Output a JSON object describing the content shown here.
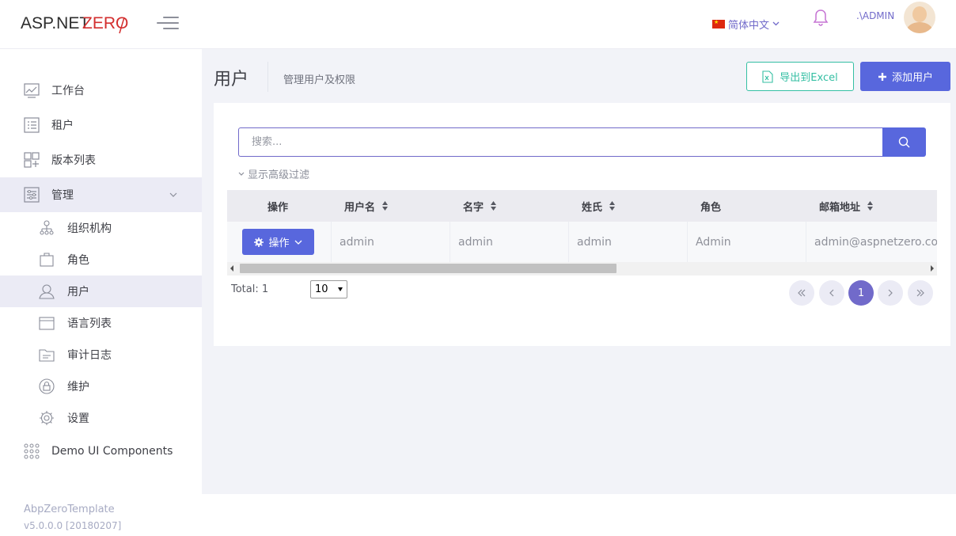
{
  "header": {
    "logo_prefix": "ASP.NET",
    "logo_suffix": "ZERO",
    "language": "简体中文",
    "user_name": ".\\ADMIN"
  },
  "sidebar": {
    "items": [
      {
        "label": "工作台",
        "icon": "chart-icon"
      },
      {
        "label": "租户",
        "icon": "list-icon"
      },
      {
        "label": "版本列表",
        "icon": "grid-icon"
      },
      {
        "label": "管理",
        "icon": "sliders-icon",
        "expanded": true
      },
      {
        "label": "Demo UI Components",
        "icon": "dots-grid-icon"
      }
    ],
    "sub_items": [
      {
        "label": "组织机构",
        "icon": "org-chart-icon"
      },
      {
        "label": "角色",
        "icon": "briefcase-icon"
      },
      {
        "label": "用户",
        "icon": "user-icon",
        "active": true
      },
      {
        "label": "语言列表",
        "icon": "window-icon"
      },
      {
        "label": "审计日志",
        "icon": "folder-icon"
      },
      {
        "label": "维护",
        "icon": "lock-icon"
      },
      {
        "label": "设置",
        "icon": "gear-icon"
      }
    ]
  },
  "page": {
    "title": "用户",
    "description": "管理用户及权限",
    "export_label": "导出到Excel",
    "add_label": "添加用户"
  },
  "search": {
    "placeholder": "搜索...",
    "value": "",
    "advanced_filter": "显示高级过滤"
  },
  "table": {
    "headers": [
      "操作",
      "用户名",
      "名字",
      "姓氏",
      "角色",
      "邮箱地址"
    ],
    "action_label": "操作",
    "rows": [
      {
        "username": "admin",
        "name": "admin",
        "surname": "admin",
        "roles": "Admin",
        "email": "admin@aspnetzero.com"
      }
    ]
  },
  "pagination": {
    "total_label": "Total: 1",
    "page_size": "10",
    "current_page": "1"
  },
  "footer": {
    "app_name": "AbpZeroTemplate",
    "version": "v5.0.0.0 [20180207]"
  },
  "colors": {
    "primary": "#5867dd",
    "accent": "#716aca",
    "success": "#34bfa3"
  }
}
